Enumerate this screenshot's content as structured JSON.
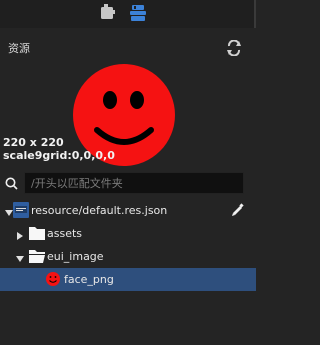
{
  "panel": {
    "title": "资源"
  },
  "preview": {
    "size_text": "220 x 220",
    "scale9grid_text": "scale9grid:0,0,0,0"
  },
  "search": {
    "placeholder": "/开头以匹配文件夹",
    "value": ""
  },
  "tree": {
    "items": [
      {
        "label": "resource/default.res.json",
        "icon": "json-file-icon",
        "level": 0
      },
      {
        "label": "assets",
        "icon": "folder-icon",
        "level": 1
      },
      {
        "label": "eui_image",
        "icon": "folder-open-icon",
        "level": 1
      },
      {
        "label": "face_png",
        "icon": "red-dot-icon",
        "level": 2
      }
    ]
  },
  "colors": {
    "selected": "#2e4f7d",
    "accent": "#3c82d8",
    "face": "#f51212"
  }
}
